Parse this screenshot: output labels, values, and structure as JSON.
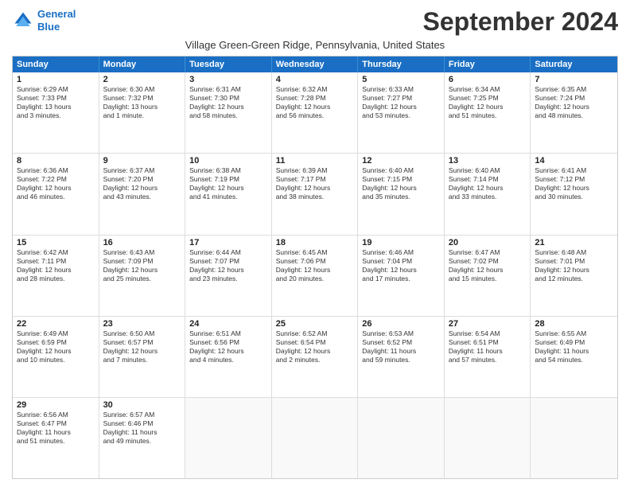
{
  "logo": {
    "line1": "General",
    "line2": "Blue"
  },
  "title": "September 2024",
  "subtitle": "Village Green-Green Ridge, Pennsylvania, United States",
  "header_days": [
    "Sunday",
    "Monday",
    "Tuesday",
    "Wednesday",
    "Thursday",
    "Friday",
    "Saturday"
  ],
  "weeks": [
    [
      {
        "day": "1",
        "text": "Sunrise: 6:29 AM\nSunset: 7:33 PM\nDaylight: 13 hours\nand 3 minutes."
      },
      {
        "day": "2",
        "text": "Sunrise: 6:30 AM\nSunset: 7:32 PM\nDaylight: 13 hours\nand 1 minute."
      },
      {
        "day": "3",
        "text": "Sunrise: 6:31 AM\nSunset: 7:30 PM\nDaylight: 12 hours\nand 58 minutes."
      },
      {
        "day": "4",
        "text": "Sunrise: 6:32 AM\nSunset: 7:28 PM\nDaylight: 12 hours\nand 56 minutes."
      },
      {
        "day": "5",
        "text": "Sunrise: 6:33 AM\nSunset: 7:27 PM\nDaylight: 12 hours\nand 53 minutes."
      },
      {
        "day": "6",
        "text": "Sunrise: 6:34 AM\nSunset: 7:25 PM\nDaylight: 12 hours\nand 51 minutes."
      },
      {
        "day": "7",
        "text": "Sunrise: 6:35 AM\nSunset: 7:24 PM\nDaylight: 12 hours\nand 48 minutes."
      }
    ],
    [
      {
        "day": "8",
        "text": "Sunrise: 6:36 AM\nSunset: 7:22 PM\nDaylight: 12 hours\nand 46 minutes."
      },
      {
        "day": "9",
        "text": "Sunrise: 6:37 AM\nSunset: 7:20 PM\nDaylight: 12 hours\nand 43 minutes."
      },
      {
        "day": "10",
        "text": "Sunrise: 6:38 AM\nSunset: 7:19 PM\nDaylight: 12 hours\nand 41 minutes."
      },
      {
        "day": "11",
        "text": "Sunrise: 6:39 AM\nSunset: 7:17 PM\nDaylight: 12 hours\nand 38 minutes."
      },
      {
        "day": "12",
        "text": "Sunrise: 6:40 AM\nSunset: 7:15 PM\nDaylight: 12 hours\nand 35 minutes."
      },
      {
        "day": "13",
        "text": "Sunrise: 6:40 AM\nSunset: 7:14 PM\nDaylight: 12 hours\nand 33 minutes."
      },
      {
        "day": "14",
        "text": "Sunrise: 6:41 AM\nSunset: 7:12 PM\nDaylight: 12 hours\nand 30 minutes."
      }
    ],
    [
      {
        "day": "15",
        "text": "Sunrise: 6:42 AM\nSunset: 7:11 PM\nDaylight: 12 hours\nand 28 minutes."
      },
      {
        "day": "16",
        "text": "Sunrise: 6:43 AM\nSunset: 7:09 PM\nDaylight: 12 hours\nand 25 minutes."
      },
      {
        "day": "17",
        "text": "Sunrise: 6:44 AM\nSunset: 7:07 PM\nDaylight: 12 hours\nand 23 minutes."
      },
      {
        "day": "18",
        "text": "Sunrise: 6:45 AM\nSunset: 7:06 PM\nDaylight: 12 hours\nand 20 minutes."
      },
      {
        "day": "19",
        "text": "Sunrise: 6:46 AM\nSunset: 7:04 PM\nDaylight: 12 hours\nand 17 minutes."
      },
      {
        "day": "20",
        "text": "Sunrise: 6:47 AM\nSunset: 7:02 PM\nDaylight: 12 hours\nand 15 minutes."
      },
      {
        "day": "21",
        "text": "Sunrise: 6:48 AM\nSunset: 7:01 PM\nDaylight: 12 hours\nand 12 minutes."
      }
    ],
    [
      {
        "day": "22",
        "text": "Sunrise: 6:49 AM\nSunset: 6:59 PM\nDaylight: 12 hours\nand 10 minutes."
      },
      {
        "day": "23",
        "text": "Sunrise: 6:50 AM\nSunset: 6:57 PM\nDaylight: 12 hours\nand 7 minutes."
      },
      {
        "day": "24",
        "text": "Sunrise: 6:51 AM\nSunset: 6:56 PM\nDaylight: 12 hours\nand 4 minutes."
      },
      {
        "day": "25",
        "text": "Sunrise: 6:52 AM\nSunset: 6:54 PM\nDaylight: 12 hours\nand 2 minutes."
      },
      {
        "day": "26",
        "text": "Sunrise: 6:53 AM\nSunset: 6:52 PM\nDaylight: 11 hours\nand 59 minutes."
      },
      {
        "day": "27",
        "text": "Sunrise: 6:54 AM\nSunset: 6:51 PM\nDaylight: 11 hours\nand 57 minutes."
      },
      {
        "day": "28",
        "text": "Sunrise: 6:55 AM\nSunset: 6:49 PM\nDaylight: 11 hours\nand 54 minutes."
      }
    ],
    [
      {
        "day": "29",
        "text": "Sunrise: 6:56 AM\nSunset: 6:47 PM\nDaylight: 11 hours\nand 51 minutes."
      },
      {
        "day": "30",
        "text": "Sunrise: 6:57 AM\nSunset: 6:46 PM\nDaylight: 11 hours\nand 49 minutes."
      },
      {
        "day": "",
        "text": ""
      },
      {
        "day": "",
        "text": ""
      },
      {
        "day": "",
        "text": ""
      },
      {
        "day": "",
        "text": ""
      },
      {
        "day": "",
        "text": ""
      }
    ]
  ]
}
